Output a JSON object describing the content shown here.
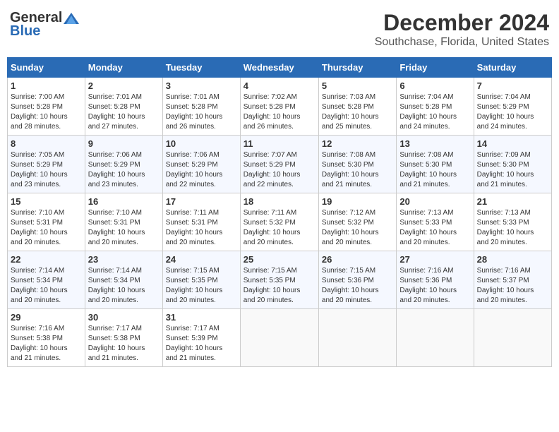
{
  "logo": {
    "general": "General",
    "blue": "Blue"
  },
  "header": {
    "month": "December 2024",
    "location": "Southchase, Florida, United States"
  },
  "weekdays": [
    "Sunday",
    "Monday",
    "Tuesday",
    "Wednesday",
    "Thursday",
    "Friday",
    "Saturday"
  ],
  "weeks": [
    [
      {
        "day": "1",
        "sunrise": "7:00 AM",
        "sunset": "5:28 PM",
        "daylight": "10 hours and 28 minutes."
      },
      {
        "day": "2",
        "sunrise": "7:01 AM",
        "sunset": "5:28 PM",
        "daylight": "10 hours and 27 minutes."
      },
      {
        "day": "3",
        "sunrise": "7:01 AM",
        "sunset": "5:28 PM",
        "daylight": "10 hours and 26 minutes."
      },
      {
        "day": "4",
        "sunrise": "7:02 AM",
        "sunset": "5:28 PM",
        "daylight": "10 hours and 26 minutes."
      },
      {
        "day": "5",
        "sunrise": "7:03 AM",
        "sunset": "5:28 PM",
        "daylight": "10 hours and 25 minutes."
      },
      {
        "day": "6",
        "sunrise": "7:04 AM",
        "sunset": "5:28 PM",
        "daylight": "10 hours and 24 minutes."
      },
      {
        "day": "7",
        "sunrise": "7:04 AM",
        "sunset": "5:29 PM",
        "daylight": "10 hours and 24 minutes."
      }
    ],
    [
      {
        "day": "8",
        "sunrise": "7:05 AM",
        "sunset": "5:29 PM",
        "daylight": "10 hours and 23 minutes."
      },
      {
        "day": "9",
        "sunrise": "7:06 AM",
        "sunset": "5:29 PM",
        "daylight": "10 hours and 23 minutes."
      },
      {
        "day": "10",
        "sunrise": "7:06 AM",
        "sunset": "5:29 PM",
        "daylight": "10 hours and 22 minutes."
      },
      {
        "day": "11",
        "sunrise": "7:07 AM",
        "sunset": "5:29 PM",
        "daylight": "10 hours and 22 minutes."
      },
      {
        "day": "12",
        "sunrise": "7:08 AM",
        "sunset": "5:30 PM",
        "daylight": "10 hours and 21 minutes."
      },
      {
        "day": "13",
        "sunrise": "7:08 AM",
        "sunset": "5:30 PM",
        "daylight": "10 hours and 21 minutes."
      },
      {
        "day": "14",
        "sunrise": "7:09 AM",
        "sunset": "5:30 PM",
        "daylight": "10 hours and 21 minutes."
      }
    ],
    [
      {
        "day": "15",
        "sunrise": "7:10 AM",
        "sunset": "5:31 PM",
        "daylight": "10 hours and 20 minutes."
      },
      {
        "day": "16",
        "sunrise": "7:10 AM",
        "sunset": "5:31 PM",
        "daylight": "10 hours and 20 minutes."
      },
      {
        "day": "17",
        "sunrise": "7:11 AM",
        "sunset": "5:31 PM",
        "daylight": "10 hours and 20 minutes."
      },
      {
        "day": "18",
        "sunrise": "7:11 AM",
        "sunset": "5:32 PM",
        "daylight": "10 hours and 20 minutes."
      },
      {
        "day": "19",
        "sunrise": "7:12 AM",
        "sunset": "5:32 PM",
        "daylight": "10 hours and 20 minutes."
      },
      {
        "day": "20",
        "sunrise": "7:13 AM",
        "sunset": "5:33 PM",
        "daylight": "10 hours and 20 minutes."
      },
      {
        "day": "21",
        "sunrise": "7:13 AM",
        "sunset": "5:33 PM",
        "daylight": "10 hours and 20 minutes."
      }
    ],
    [
      {
        "day": "22",
        "sunrise": "7:14 AM",
        "sunset": "5:34 PM",
        "daylight": "10 hours and 20 minutes."
      },
      {
        "day": "23",
        "sunrise": "7:14 AM",
        "sunset": "5:34 PM",
        "daylight": "10 hours and 20 minutes."
      },
      {
        "day": "24",
        "sunrise": "7:15 AM",
        "sunset": "5:35 PM",
        "daylight": "10 hours and 20 minutes."
      },
      {
        "day": "25",
        "sunrise": "7:15 AM",
        "sunset": "5:35 PM",
        "daylight": "10 hours and 20 minutes."
      },
      {
        "day": "26",
        "sunrise": "7:15 AM",
        "sunset": "5:36 PM",
        "daylight": "10 hours and 20 minutes."
      },
      {
        "day": "27",
        "sunrise": "7:16 AM",
        "sunset": "5:36 PM",
        "daylight": "10 hours and 20 minutes."
      },
      {
        "day": "28",
        "sunrise": "7:16 AM",
        "sunset": "5:37 PM",
        "daylight": "10 hours and 20 minutes."
      }
    ],
    [
      {
        "day": "29",
        "sunrise": "7:16 AM",
        "sunset": "5:38 PM",
        "daylight": "10 hours and 21 minutes."
      },
      {
        "day": "30",
        "sunrise": "7:17 AM",
        "sunset": "5:38 PM",
        "daylight": "10 hours and 21 minutes."
      },
      {
        "day": "31",
        "sunrise": "7:17 AM",
        "sunset": "5:39 PM",
        "daylight": "10 hours and 21 minutes."
      },
      null,
      null,
      null,
      null
    ]
  ],
  "labels": {
    "sunrise": "Sunrise:",
    "sunset": "Sunset:",
    "daylight": "Daylight:"
  }
}
